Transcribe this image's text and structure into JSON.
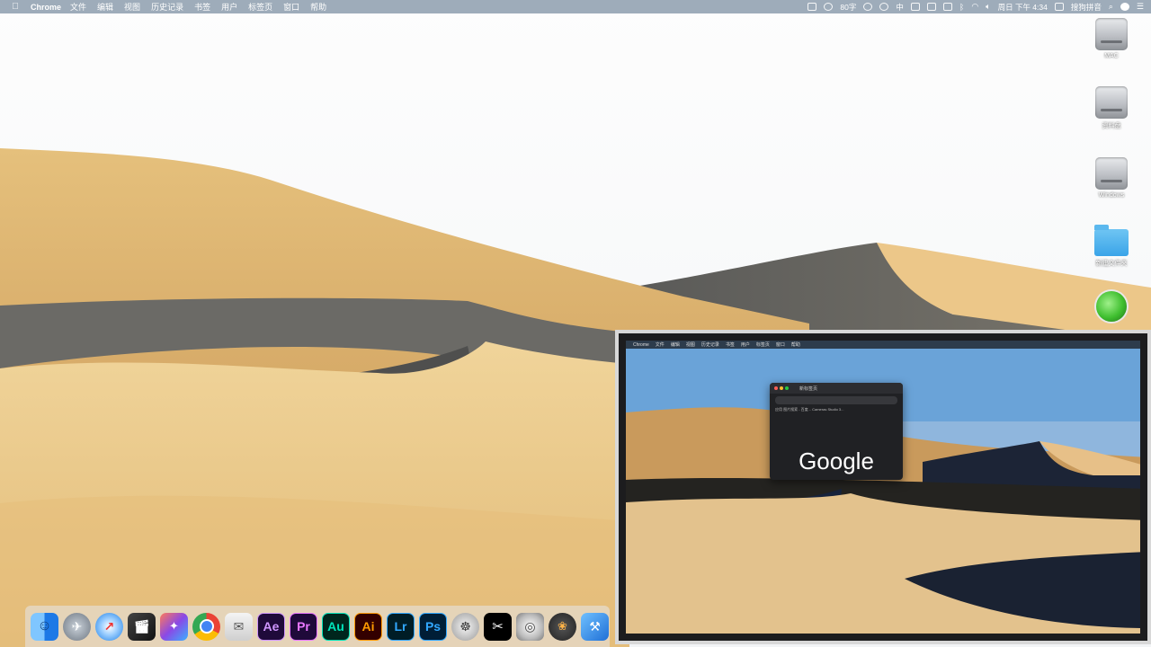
{
  "menubar": {
    "apple_icon": "apple-icon",
    "app_name": "Chrome",
    "menus": [
      "文件",
      "编辑",
      "视图",
      "历史记录",
      "书签",
      "用户",
      "标签页",
      "窗口",
      "帮助"
    ],
    "status": {
      "battery_text": "80字",
      "clock": "周日 下午 4:34",
      "input_method": "搜狗拼音",
      "input_char": "中"
    }
  },
  "desktop": {
    "icons": [
      {
        "label": "MAC",
        "icon": "hard-disk-icon"
      },
      {
        "label": "资料盘",
        "icon": "hard-disk-icon"
      },
      {
        "label": "Windows",
        "icon": "hard-disk-icon"
      },
      {
        "label": "新建文件夹",
        "icon": "folder-icon"
      },
      {
        "label": "",
        "icon": "app-globe-icon"
      }
    ]
  },
  "dock": {
    "items": [
      {
        "name": "finder",
        "text": "",
        "bg": "#2d8ff0"
      },
      {
        "name": "launchpad",
        "text": "",
        "bg": "#7d8792"
      },
      {
        "name": "safari",
        "text": "",
        "bg": "#1c8ff2"
      },
      {
        "name": "final-cut-pro",
        "text": "",
        "bg": "#2a2a2a"
      },
      {
        "name": "motion",
        "text": "",
        "bg": "#8f4fe0"
      },
      {
        "name": "chrome",
        "text": "",
        "bg": "#ffffff"
      },
      {
        "name": "mail-app",
        "text": "",
        "bg": "#e9e9e9"
      },
      {
        "name": "after-effects",
        "text": "Ae",
        "bg": "#1f0a3a",
        "fg": "#cf96fd"
      },
      {
        "name": "premiere",
        "text": "Pr",
        "bg": "#1f0a3a",
        "fg": "#ea77ff"
      },
      {
        "name": "audition",
        "text": "Au",
        "bg": "#00261d",
        "fg": "#00e4bb"
      },
      {
        "name": "illustrator",
        "text": "Ai",
        "bg": "#330000",
        "fg": "#ff9a00"
      },
      {
        "name": "lightroom",
        "text": "Lr",
        "bg": "#001d26",
        "fg": "#31a8ff"
      },
      {
        "name": "photoshop",
        "text": "Ps",
        "bg": "#001e36",
        "fg": "#31a8ff"
      },
      {
        "name": "film-editor",
        "text": "",
        "bg": "#3a3a3a"
      },
      {
        "name": "capcut",
        "text": "",
        "bg": "#000000"
      },
      {
        "name": "dvd-player",
        "text": "",
        "bg": "#dcdcdc"
      },
      {
        "name": "davinci-resolve",
        "text": "",
        "bg": "#2b2b2b"
      },
      {
        "name": "xcode",
        "text": "",
        "bg": "#3b8ee8"
      }
    ]
  },
  "video": {
    "logo": "Google",
    "tab_title": "新标签页",
    "bookmarks": "应用   图片搜索 - 百度...   Cameras Studio 3..."
  }
}
